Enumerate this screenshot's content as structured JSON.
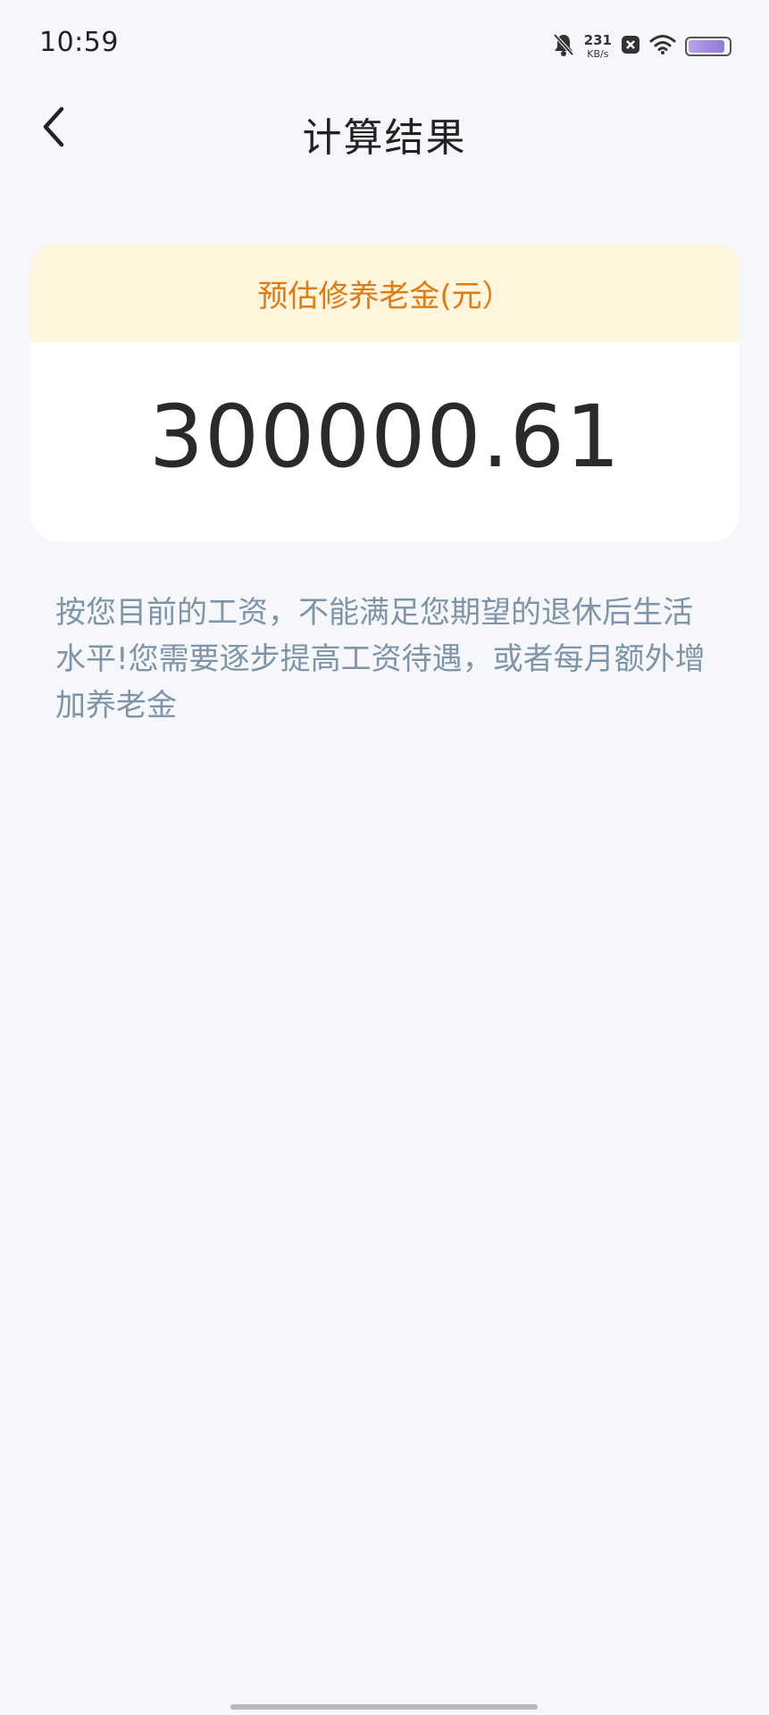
{
  "status_bar": {
    "time": "10:59",
    "net_speed_value": "231",
    "net_speed_unit": "KB/s",
    "icons": [
      "bell-muted-icon",
      "close-badge-icon",
      "wifi-icon",
      "battery-icon"
    ],
    "battery_level": 0.9,
    "battery_color": "#9c86dd"
  },
  "nav": {
    "title": "计算结果",
    "back_icon": "chevron-left-icon"
  },
  "result_card": {
    "label": "预估修养老金(元）",
    "amount": "300000.61",
    "label_color": "#e27a14",
    "header_bg": "#fff6dd"
  },
  "advice": {
    "text": "按您目前的工资，不能满足您期望的退休后生活水平!您需要逐步提高工资待遇，或者每月额外增加养老金"
  },
  "theme": {
    "background": "#f6f7fa",
    "advice_color": "#7e94a8"
  }
}
